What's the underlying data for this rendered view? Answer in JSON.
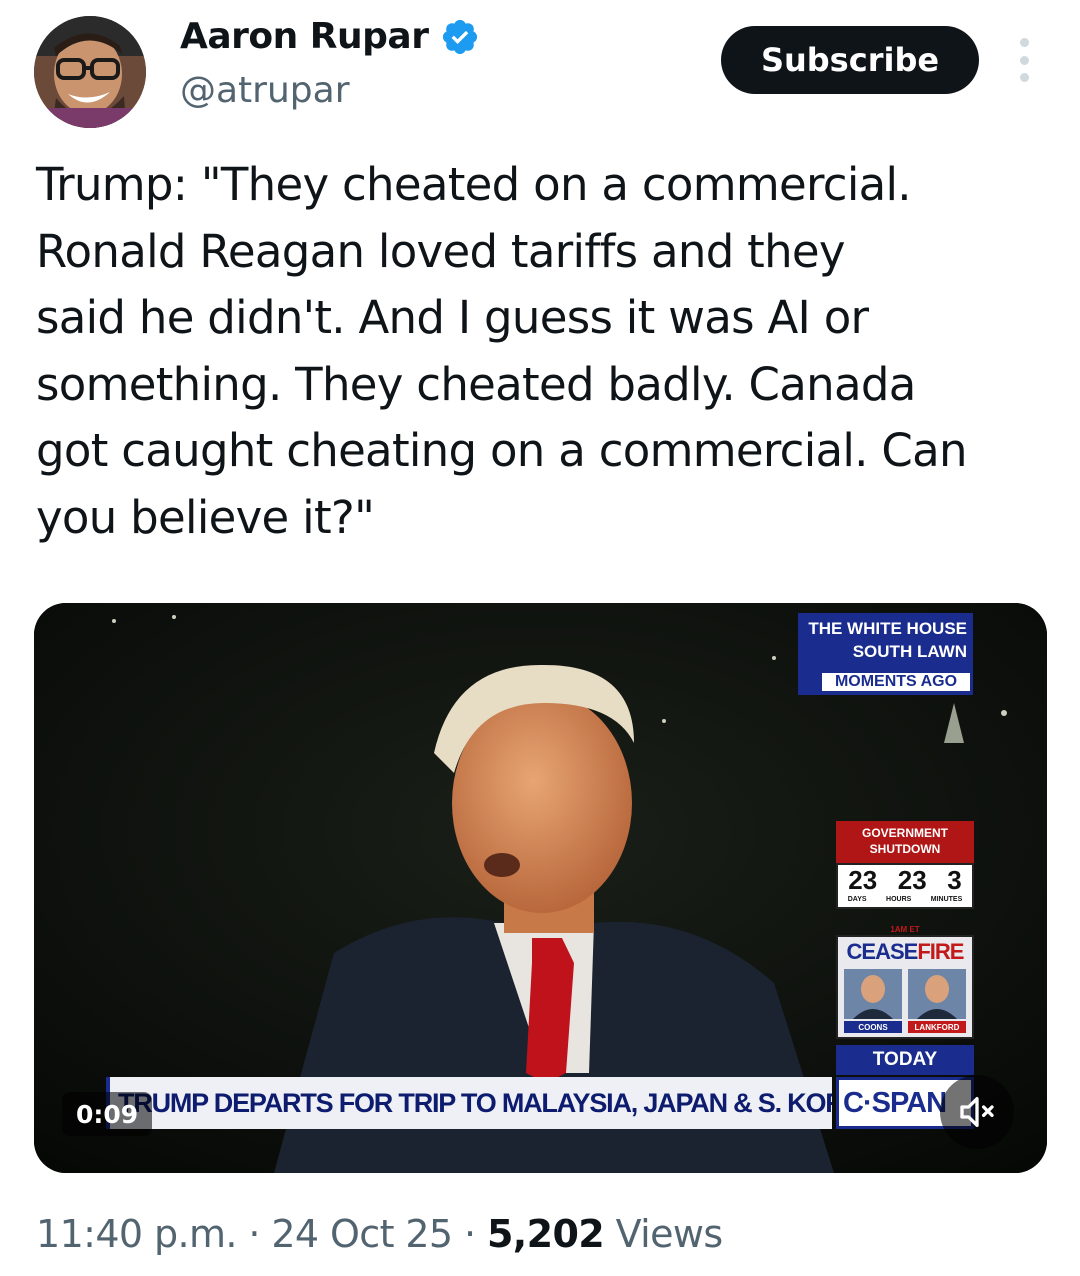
{
  "author": {
    "display_name": "Aaron Rupar",
    "handle": "@atrupar",
    "verified_badge_icon": "verified-badge-icon",
    "verified_color": "#1d9bf0"
  },
  "header": {
    "subscribe_label": "Subscribe",
    "more_icon": "more-options-icon"
  },
  "tweet": {
    "text": "Trump: \"They cheated on a commercial.\nRonald Reagan loved tariffs and they\nsaid he didn't. And I guess it was AI or\nsomething. They cheated badly. Canada\ngot caught cheating on a commercial. Can\nyou believe it?\""
  },
  "video": {
    "timestamp": "0:09",
    "mute_icon": "muted-speaker-icon",
    "overlay": {
      "location_line1": "THE WHITE HOUSE",
      "location_line2": "SOUTH LAWN",
      "moments": "MOMENTS AGO",
      "shutdown_line1": "GOVERNMENT",
      "shutdown_line2": "SHUTDOWN",
      "counter": {
        "days": "23",
        "hours": "23",
        "minutes": "3"
      },
      "counter_units": {
        "days": "DAYS",
        "hours": "HOURS",
        "minutes": "MINUTES"
      },
      "ceasefire_time": "1AM ET",
      "ceasefire_a": "CEASE",
      "ceasefire_b": "FIRE",
      "guest_left": "COONS",
      "guest_right": "LANKFORD",
      "today": "TODAY",
      "chyron": "TRUMP DEPARTS FOR TRIP TO MALAYSIA, JAPAN & S. KOREA",
      "network": "C·SPAN"
    }
  },
  "meta": {
    "time": "11:40 p.m.",
    "separator": " · ",
    "date": "24 Oct 25",
    "views_count": "5,202",
    "views_label": " Views"
  }
}
